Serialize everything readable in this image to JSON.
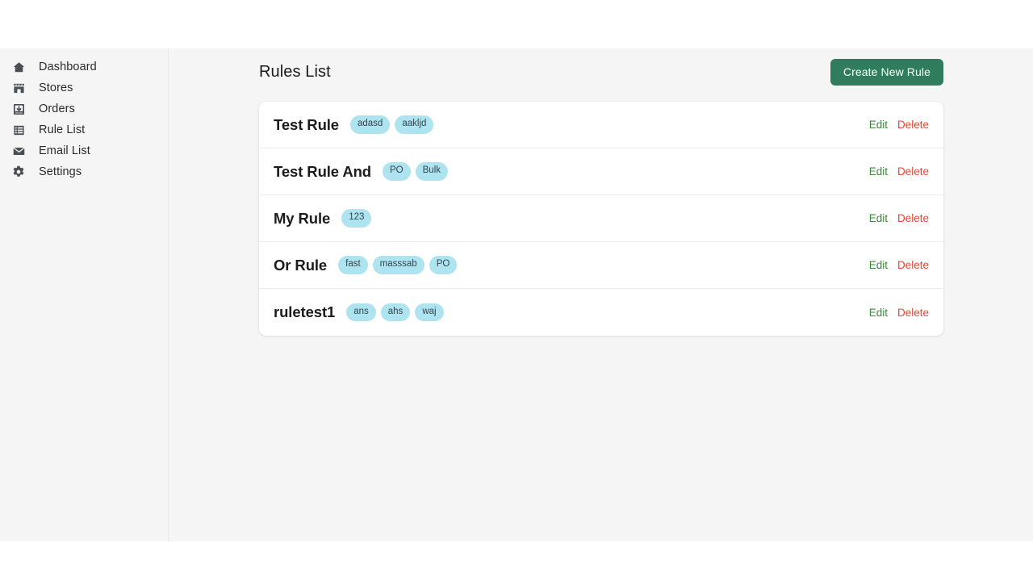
{
  "sidebar": {
    "items": [
      {
        "label": "Dashboard",
        "icon": "home-icon"
      },
      {
        "label": "Stores",
        "icon": "store-icon"
      },
      {
        "label": "Orders",
        "icon": "inbox-download-icon"
      },
      {
        "label": "Rule List",
        "icon": "list-icon"
      },
      {
        "label": "Email List",
        "icon": "envelope-icon"
      },
      {
        "label": "Settings",
        "icon": "gear-icon"
      }
    ]
  },
  "header": {
    "title": "Rules List",
    "create_button": "Create New Rule"
  },
  "actions": {
    "edit": "Edit",
    "delete": "Delete"
  },
  "colors": {
    "create_button_bg": "#2f7d5c",
    "tag_bg": "#aee3f0",
    "edit": "#3a8a3a",
    "delete": "#e8462f",
    "page_bg": "#f5f5f5",
    "card_bg": "#ffffff"
  },
  "rules": [
    {
      "name": "Test Rule",
      "tags": [
        "adasd",
        "aakljd"
      ]
    },
    {
      "name": "Test Rule And",
      "tags": [
        "PO",
        "Bulk"
      ]
    },
    {
      "name": "My Rule",
      "tags": [
        "123"
      ]
    },
    {
      "name": "Or Rule",
      "tags": [
        "fast",
        "masssab",
        "PO"
      ]
    },
    {
      "name": "ruletest1",
      "tags": [
        "ans",
        "ahs",
        "waj"
      ]
    }
  ]
}
